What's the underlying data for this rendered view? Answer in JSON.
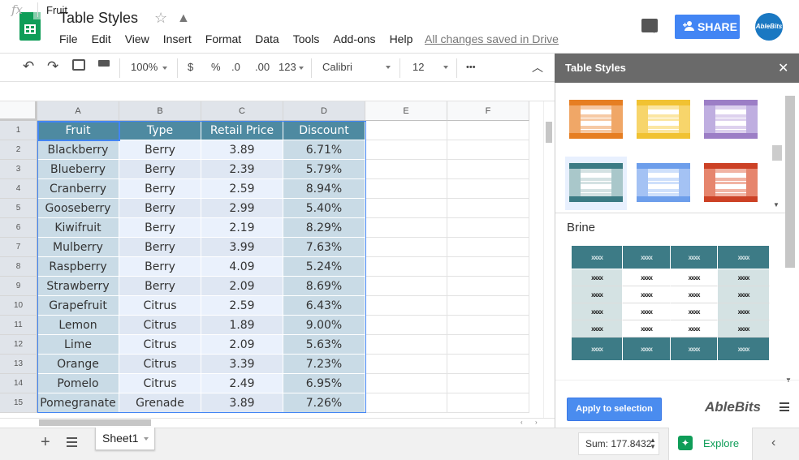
{
  "app": {
    "title": "Table Styles",
    "save_status": "All changes saved in Drive",
    "share_label": "SHARE",
    "avatar_text": "AbleBits",
    "menu": [
      "File",
      "Edit",
      "View",
      "Insert",
      "Format",
      "Data",
      "Tools",
      "Add-ons",
      "Help"
    ]
  },
  "toolbar": {
    "zoom": "100%",
    "currency": "$",
    "percent": "%",
    "decrease_decimal": ".0",
    "increase_decimal": ".00",
    "number_format": "123",
    "font": "Calibri",
    "font_size": "12",
    "more": "•••"
  },
  "formula_bar": {
    "fx": "fx",
    "value": "Fruit"
  },
  "grid": {
    "columns": [
      "A",
      "B",
      "C",
      "D",
      "E",
      "F"
    ],
    "row_numbers": [
      "1",
      "2",
      "3",
      "4",
      "5",
      "6",
      "7",
      "8",
      "9",
      "10",
      "11",
      "12",
      "13",
      "14",
      "15"
    ],
    "header": [
      "Fruit",
      "Type",
      "Retail Price",
      "Discount"
    ],
    "rows": [
      [
        "Blackberry",
        "Berry",
        "3.89",
        "6.71%"
      ],
      [
        "Blueberry",
        "Berry",
        "2.39",
        "5.79%"
      ],
      [
        "Cranberry",
        "Berry",
        "2.59",
        "8.94%"
      ],
      [
        "Gooseberry",
        "Berry",
        "2.99",
        "5.40%"
      ],
      [
        "Kiwifruit",
        "Berry",
        "2.19",
        "8.29%"
      ],
      [
        "Mulberry",
        "Berry",
        "3.99",
        "7.63%"
      ],
      [
        "Raspberry",
        "Berry",
        "4.09",
        "5.24%"
      ],
      [
        "Strawberry",
        "Berry",
        "2.09",
        "8.69%"
      ],
      [
        "Grapefruit",
        "Citrus",
        "2.59",
        "6.43%"
      ],
      [
        "Lemon",
        "Citrus",
        "1.89",
        "9.00%"
      ],
      [
        "Lime",
        "Citrus",
        "2.09",
        "5.63%"
      ],
      [
        "Orange",
        "Citrus",
        "3.39",
        "7.23%"
      ],
      [
        "Pomelo",
        "Citrus",
        "2.49",
        "6.95%"
      ],
      [
        "Pomegranate",
        "Grenade",
        "3.89",
        "7.26%"
      ]
    ],
    "colors": {
      "header_bg": "#4e8aa1",
      "header_text": "#ffffff",
      "first_col_bg": "#c9dbe6",
      "last_col_bg": "#c9dbe6",
      "band_odd": "#eaf1fc",
      "band_even": "#dfe7f3"
    }
  },
  "bottom": {
    "sheet_name": "Sheet1",
    "sum": "Sum: 177.8432",
    "explore": "Explore"
  },
  "sidebar": {
    "title": "Table Styles",
    "selected_style": "Brine",
    "apply_label": "Apply to selection",
    "logo": "AbleBits",
    "styles": [
      {
        "name": "orange",
        "header": "#e67e22",
        "band": "#f6c9a4",
        "col": "#f0a767"
      },
      {
        "name": "yellow",
        "header": "#f1c232",
        "band": "#fbe6a2",
        "col": "#f7d56b"
      },
      {
        "name": "purple",
        "header": "#9c7ec6",
        "band": "#ddd1ee",
        "col": "#bfaee0"
      },
      {
        "name": "teal",
        "header": "#3c7b84",
        "band": "#d4e2e3",
        "col": "#a9c7ca"
      },
      {
        "name": "blue",
        "header": "#6d9eeb",
        "band": "#cfe0fb",
        "col": "#a4c2f4"
      },
      {
        "name": "red",
        "header": "#cc4125",
        "band": "#f1b4a4",
        "col": "#e6856d"
      }
    ],
    "preview": {
      "header_bg": "#3d7b86",
      "side_bg": "#d4e2e3",
      "body_bg": "#ffffff",
      "cell_mark": "xxxx"
    }
  }
}
